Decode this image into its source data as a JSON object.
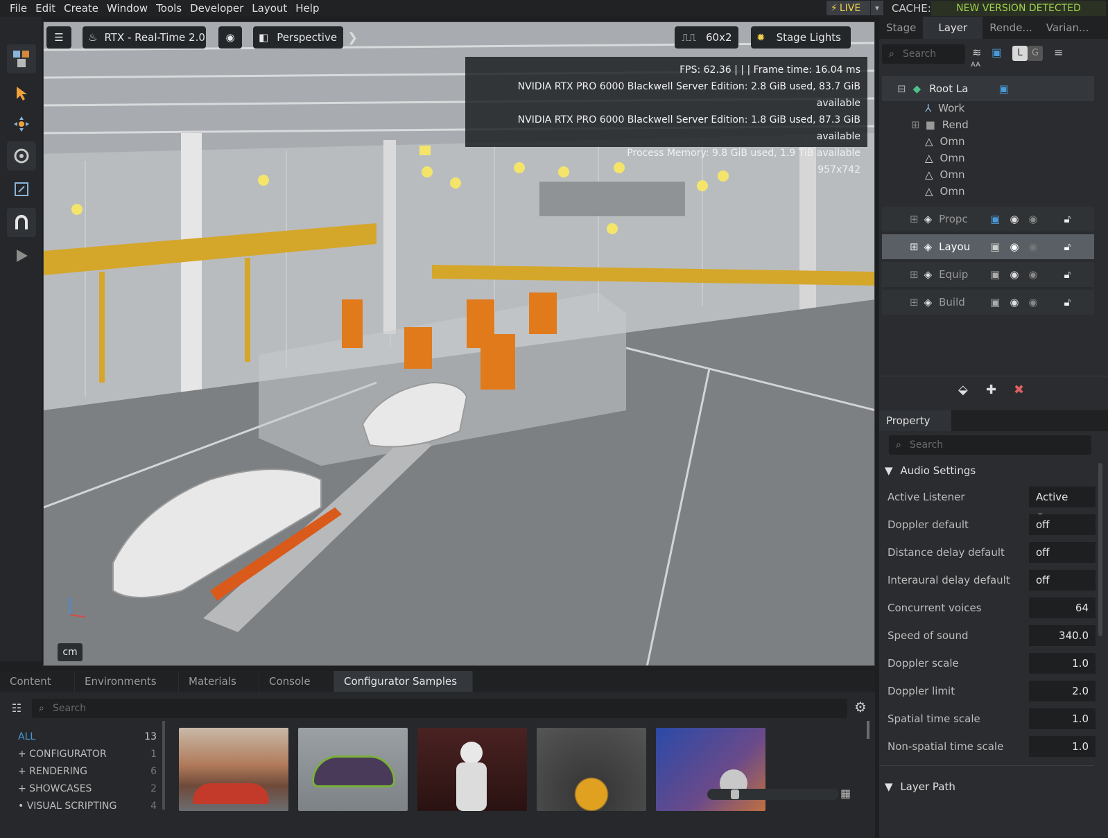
{
  "menu": [
    "File",
    "Edit",
    "Create",
    "Window",
    "Tools",
    "Developer",
    "Layout",
    "Help"
  ],
  "live_label": "LIVE",
  "cache_label": "CACHE:",
  "new_version": "NEW VERSION DETECTED",
  "viewport": {
    "renderer": "RTX - Real-Time 2.0",
    "camera": "Perspective",
    "resolution": "60x2",
    "lights": "Stage Lights",
    "stats": [
      "FPS: 62.36 | | | Frame time: 16.04 ms",
      "NVIDIA RTX PRO 6000 Blackwell Server Edition: 2.8 GiB used, 83.7 GiB available",
      "NVIDIA RTX PRO 6000 Blackwell Server Edition: 1.8 GiB used, 87.3 GiB available",
      "Process Memory: 9.8 GiB used, 1.9 TiB available",
      "957x742"
    ],
    "units": "cm"
  },
  "layer_tabs": [
    "Stage",
    "Layer",
    "Rende...",
    "Varian..."
  ],
  "layer_search": "Search",
  "layer_aa": "AA",
  "layer_lg": [
    "L",
    "G"
  ],
  "layers": {
    "root": "Root La",
    "children": [
      "Work",
      "Rend",
      "Omn",
      "Omn",
      "Omn",
      "Omn"
    ],
    "sublayers": [
      "Propc",
      "Layou",
      "Equip",
      "Build"
    ]
  },
  "property": {
    "title": "Property",
    "search": "Search",
    "section": "Audio Settings",
    "rows": [
      {
        "label": "Active Listener",
        "value": "Active Came"
      },
      {
        "label": "Doppler default",
        "value": "off"
      },
      {
        "label": "Distance delay default",
        "value": "off"
      },
      {
        "label": "Interaural delay default",
        "value": "off"
      },
      {
        "label": "Concurrent voices",
        "value": "64"
      },
      {
        "label": "Speed of sound",
        "value": "340.0"
      },
      {
        "label": "Doppler scale",
        "value": "1.0"
      },
      {
        "label": "Doppler limit",
        "value": "2.0"
      },
      {
        "label": "Spatial time scale",
        "value": "1.0"
      },
      {
        "label": "Non-spatial time scale",
        "value": "1.0"
      }
    ],
    "section2": "Layer Path"
  },
  "bottom": {
    "tabs": [
      "Content",
      "Environments",
      "Materials",
      "Console",
      "Configurator Samples"
    ],
    "search": "Search",
    "categories": [
      {
        "name": "ALL",
        "count": "13"
      },
      {
        "name": "+ CONFIGURATOR",
        "count": "1"
      },
      {
        "name": "+ RENDERING",
        "count": "6"
      },
      {
        "name": "+ SHOWCASES",
        "count": "2"
      },
      {
        "name": "• VISUAL SCRIPTING",
        "count": "4"
      }
    ]
  }
}
